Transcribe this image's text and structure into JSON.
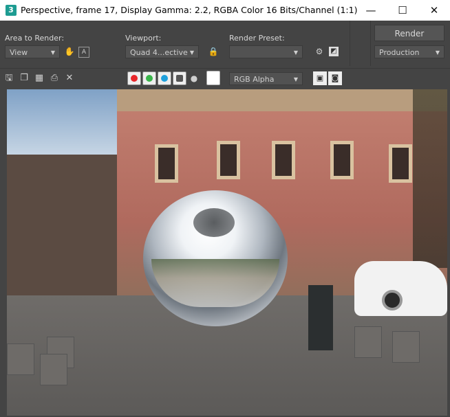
{
  "window": {
    "icon_glyph": "3",
    "title": "Perspective, frame 17, Display Gamma: 2.2, RGBA Color 16 Bits/Channel (1:1)",
    "controls": {
      "minimize": "—",
      "maximize": "☐",
      "close": "✕"
    }
  },
  "panel": {
    "area_label": "Area to Render:",
    "area_value": "View",
    "viewport_label": "Viewport:",
    "viewport_value": "Quad 4...ective",
    "preset_label": "Render Preset:",
    "preset_value": "",
    "render_button": "Render",
    "production_value": "Production"
  },
  "toolbar": {
    "channel_display": "RGB Alpha",
    "channels": [
      {
        "name": "red",
        "color": "#e8262a"
      },
      {
        "name": "green",
        "color": "#39b54a"
      },
      {
        "name": "blue",
        "color": "#1ea0dc"
      }
    ]
  },
  "icons": [
    "save-icon",
    "copy-icon",
    "clone-icon",
    "print-icon",
    "clear-icon",
    "alpha-icon",
    "mono-icon",
    "swatch-icon",
    "lock-icon",
    "pan-icon",
    "auto-region-icon",
    "env-settings-icon",
    "gamma-icon"
  ]
}
